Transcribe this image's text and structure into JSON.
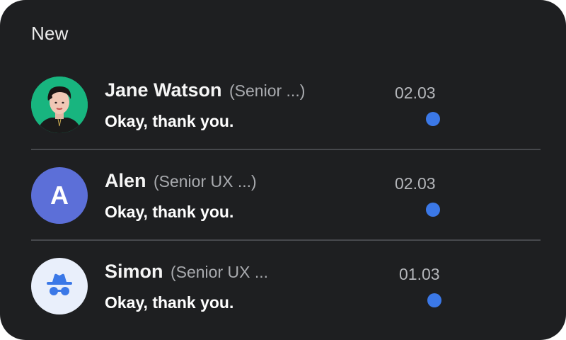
{
  "section": {
    "title": "New"
  },
  "messages": [
    {
      "name": "Jane Watson",
      "role": "(Senior ...)",
      "preview": "Okay, thank you.",
      "date": "02.03",
      "avatar_type": "photo",
      "avatar_bg": "#18b57f",
      "unread": true
    },
    {
      "name": "Alen",
      "role": "(Senior UX ...)",
      "preview": "Okay, thank you.",
      "date": "02.03",
      "avatar_type": "letter",
      "avatar_letter": "A",
      "avatar_bg": "#5c6fd8",
      "unread": true
    },
    {
      "name": "Simon",
      "role": "(Senior UX ...",
      "preview": "Okay, thank you.",
      "date": "01.03",
      "avatar_type": "icon",
      "avatar_icon": "incognito-icon",
      "avatar_bg": "#e9effb",
      "unread": true
    }
  ],
  "colors": {
    "card_bg": "#1e1f21",
    "unread_dot": "#3b78e7",
    "divider": "#46484c"
  }
}
